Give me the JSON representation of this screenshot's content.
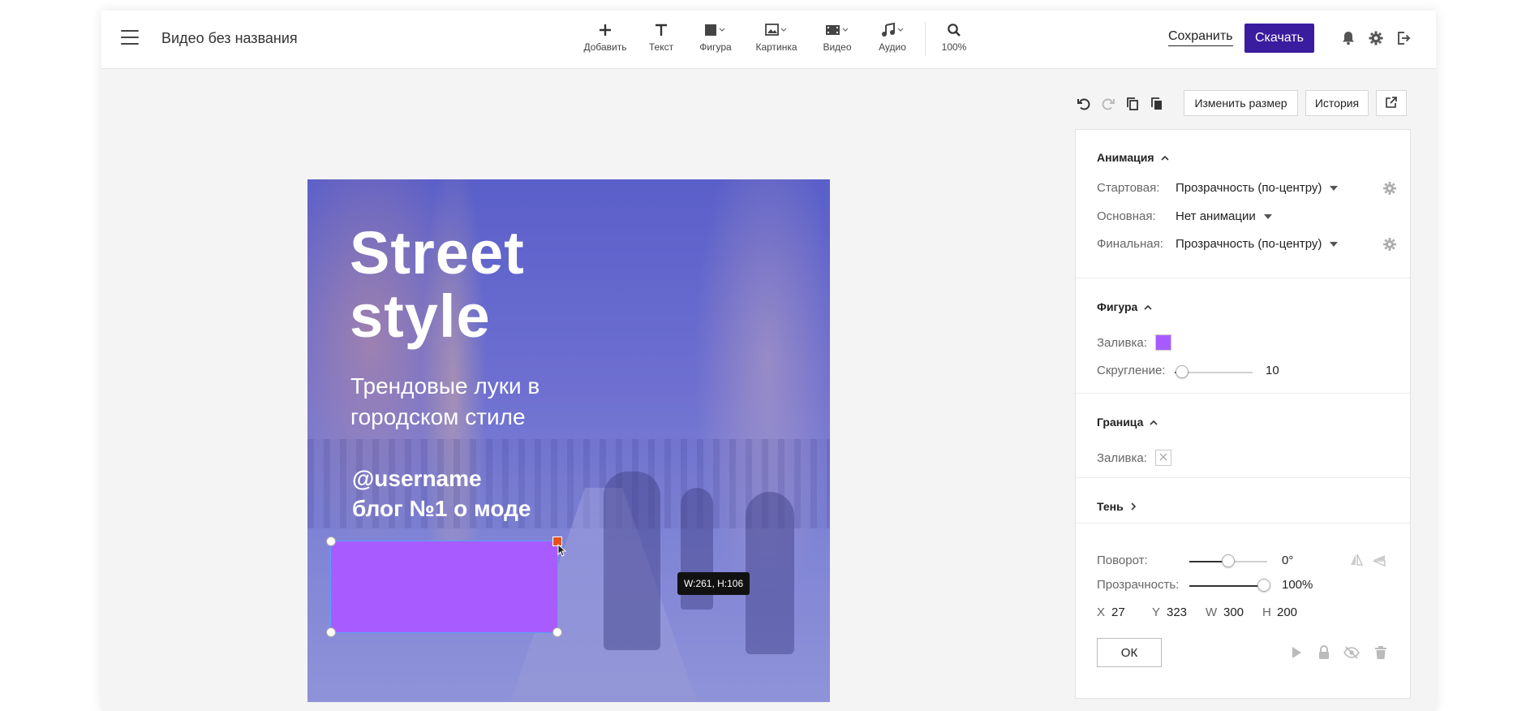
{
  "header": {
    "doc_title": "Видео без названия",
    "tools": [
      {
        "name": "add",
        "label": "Добавить"
      },
      {
        "name": "text",
        "label": "Текст"
      },
      {
        "name": "shape",
        "label": "Фигура"
      },
      {
        "name": "image",
        "label": "Картинка"
      },
      {
        "name": "video",
        "label": "Видео"
      },
      {
        "name": "audio",
        "label": "Аудио"
      }
    ],
    "zoom": "100%",
    "save_label": "Сохранить",
    "download_label": "Скачать"
  },
  "toolbar": {
    "resize_label": "Изменить размер",
    "history_label": "История"
  },
  "canvas": {
    "title_line1": "Street",
    "title_line2": "style",
    "subtitle_line1": "Трендовые луки в",
    "subtitle_line2": "городском стиле",
    "user_line1": "@username",
    "user_line2": "блог №1 о моде",
    "shape_color": "#a85cff",
    "dimension_tooltip": "W:261, H:106"
  },
  "panel": {
    "animation": {
      "title": "Анимация",
      "start_label": "Стартовая:",
      "start_value": "Прозрачность (по-центру)",
      "main_label": "Основная:",
      "main_value": "Нет анимации",
      "final_label": "Финальная:",
      "final_value": "Прозрачность (по-центру)"
    },
    "shape": {
      "title": "Фигура",
      "fill_label": "Заливка:",
      "fill_color": "#a85cff",
      "rounding_label": "Скругление:",
      "rounding_value": "10"
    },
    "border": {
      "title": "Граница",
      "fill_label": "Заливка:"
    },
    "shadow": {
      "title": "Тень"
    },
    "transform": {
      "rotation_label": "Поворот:",
      "rotation_value": "0°",
      "opacity_label": "Прозрачность:",
      "opacity_value": "100%",
      "x_label": "X",
      "x_value": "27",
      "y_label": "Y",
      "y_value": "323",
      "w_label": "W",
      "w_value": "300",
      "h_label": "H",
      "h_value": "200"
    },
    "ok_label": "ОК"
  },
  "colors": {
    "accent": "#3a1c9e",
    "shape_fill": "#a85cff",
    "selection": "#5aa0ff",
    "active_handle": "#e8521a"
  }
}
